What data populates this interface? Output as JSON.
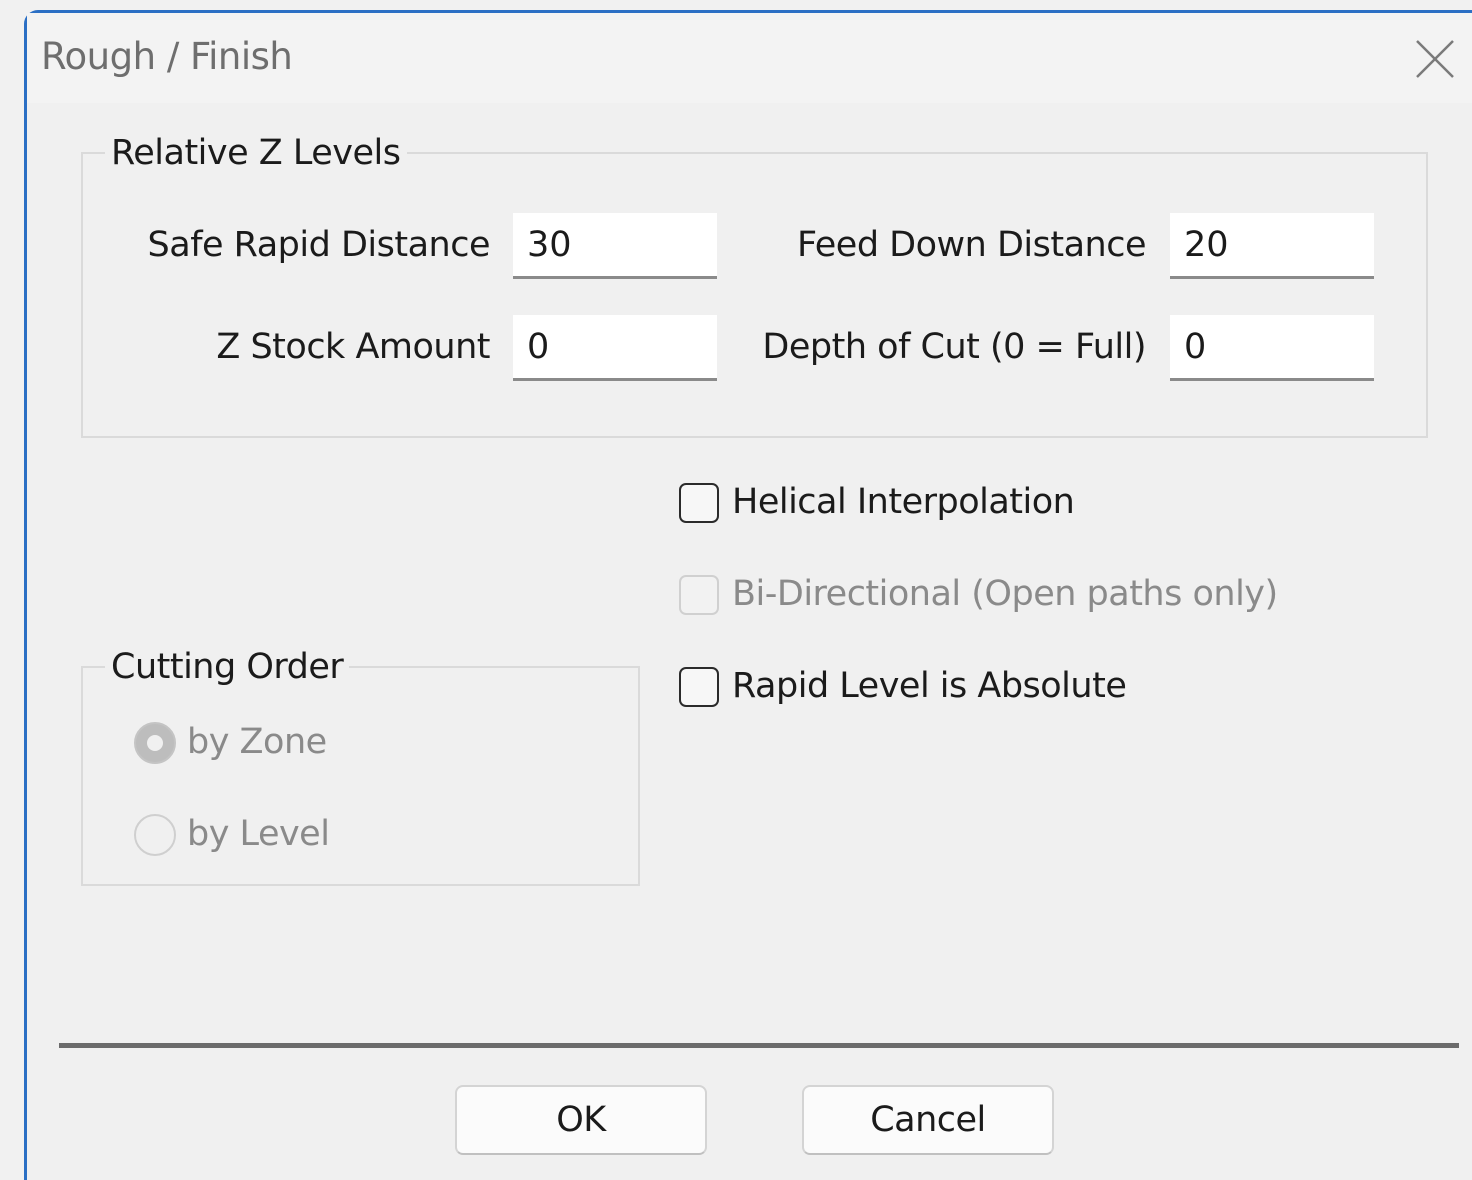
{
  "window": {
    "title": "Rough / Finish",
    "close_icon": "close-icon"
  },
  "relative_z_levels": {
    "label": "Relative Z Levels",
    "safe_rapid_distance": {
      "label": "Safe Rapid Distance",
      "value": "30"
    },
    "feed_down_distance": {
      "label": "Feed Down Distance",
      "value": "20"
    },
    "z_stock_amount": {
      "label": "Z Stock Amount",
      "value": "0"
    },
    "depth_of_cut": {
      "label": "Depth of Cut (0 = Full)",
      "value": "0"
    }
  },
  "options": {
    "helical_interpolation": {
      "label": "Helical Interpolation",
      "checked": false,
      "enabled": true
    },
    "bi_directional": {
      "label": "Bi-Directional (Open paths only)",
      "checked": false,
      "enabled": false
    },
    "rapid_level_absolute": {
      "label": "Rapid Level is Absolute",
      "checked": false,
      "enabled": true
    }
  },
  "cutting_order": {
    "label": "Cutting Order",
    "by_zone": {
      "label": "by Zone",
      "selected": true,
      "enabled": false
    },
    "by_level": {
      "label": "by Level",
      "selected": false,
      "enabled": false
    }
  },
  "buttons": {
    "ok": "OK",
    "cancel": "Cancel"
  },
  "colors": {
    "window_border": "#2b6fc4",
    "background": "#f0f0f0",
    "disabled_text": "#8a8a8a"
  }
}
